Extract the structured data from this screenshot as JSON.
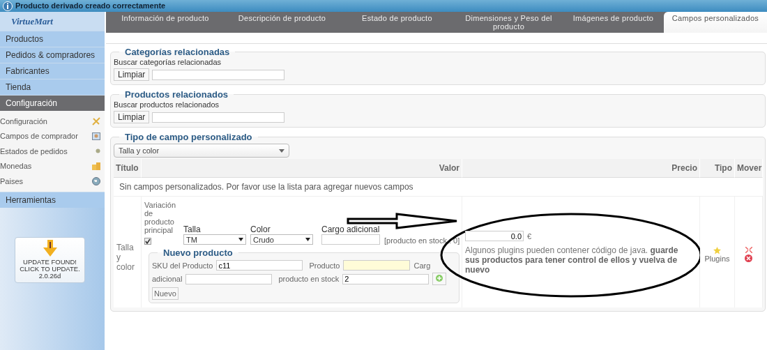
{
  "notice": {
    "text": "Producto derivado creado correctamente"
  },
  "sidebar": {
    "logo": "VirtueMart",
    "menu": [
      {
        "label": "Productos",
        "selected": false
      },
      {
        "label": "Pedidos & compradores",
        "selected": false
      },
      {
        "label": "Fabricantes",
        "selected": false
      },
      {
        "label": "Tienda",
        "selected": false
      },
      {
        "label": "Configuración",
        "selected": true
      }
    ],
    "submenu": [
      {
        "label": "Configuración",
        "kind": "tools"
      },
      {
        "label": "Campos de comprador",
        "kind": "card"
      },
      {
        "label": "Estados de pedidos",
        "kind": "dot"
      },
      {
        "label": "Monedas",
        "kind": "coins"
      },
      {
        "label": "Paises",
        "kind": "globe"
      }
    ],
    "tools": {
      "label": "Herramientas",
      "selected": false
    },
    "update": [
      "UPDATE FOUND!",
      "CLICK TO UPDATE.",
      "2.0.26d"
    ]
  },
  "tabs": [
    {
      "label": "Información de producto",
      "selected": false
    },
    {
      "label": "Descripción de producto",
      "selected": false
    },
    {
      "label": "Estado de producto",
      "selected": false
    },
    {
      "label": "Dimensiones y Peso del producto",
      "selected": false
    },
    {
      "label": "Imágenes de producto",
      "selected": false
    },
    {
      "label": "Campos personalizados",
      "selected": true
    }
  ],
  "related_categories": {
    "legend": "Categorías relacionadas",
    "label": "Buscar categorías relacionadas",
    "button": "Limpiar"
  },
  "related_products": {
    "legend": "Productos relacionados",
    "label": "Buscar productos relacionados",
    "button": "Limpiar"
  },
  "custom_field": {
    "legend": "Tipo de campo personalizado",
    "select": "Talla y color",
    "columns": [
      "Título",
      "Valor",
      "Precio",
      "Tipo",
      "Mover"
    ],
    "empty_message": "Sin campos personalizados. Por favor use la lista para agregar nuevos campos",
    "row": {
      "title": "Talla y color",
      "variant_label": "Variación de producto principal",
      "checked": true,
      "fields": [
        {
          "label": "Talla",
          "value": "TM"
        },
        {
          "label": "Color",
          "value": "Crudo"
        }
      ],
      "extra_label": "Cargo adicional",
      "stock": "[producto en stock : 0]",
      "new_product": {
        "legend": "Nuevo producto",
        "sku_label": "SKU del Producto",
        "sku_value": "c11",
        "product_label": "Producto",
        "cargo_cut": "Carg",
        "extra_label": "adicional",
        "stock_label": "producto en stock",
        "stock_value": "2",
        "button": "Nuevo"
      },
      "price": "0.0",
      "currency": "€",
      "note": "Algunos plugins pueden contener código de java. **guarde sus productos para tener control de ellos y vuelva de nuevo**",
      "type": "Plugins"
    }
  }
}
